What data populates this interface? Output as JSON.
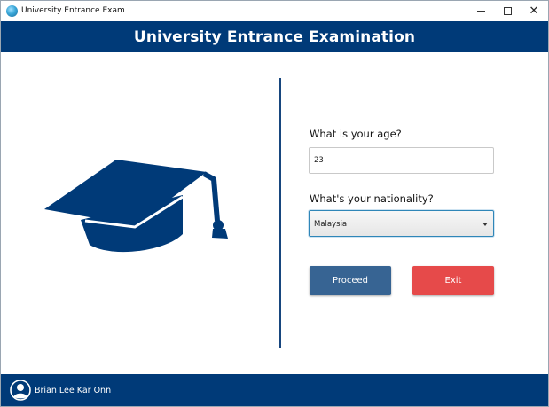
{
  "window": {
    "title": "University Entrance Exam",
    "icon": "globe-icon",
    "controls": [
      "minimize-icon",
      "maximize-icon",
      "close-icon"
    ]
  },
  "header": {
    "title": "University Entrance Examination"
  },
  "illustration": {
    "icon": "graduation-cap-icon",
    "color": "#003a78"
  },
  "form": {
    "age_label": "What is your age?",
    "age_value": "23",
    "nationality_label": "What's your nationality?",
    "nationality_value": "Malaysia"
  },
  "buttons": {
    "proceed_label": "Proceed",
    "exit_label": "Exit"
  },
  "footer": {
    "user_name": "Brian Lee Kar Onn",
    "avatar_icon": "user-avatar-icon"
  },
  "colors": {
    "primary": "#003a78",
    "proceed": "#376493",
    "exit": "#e64a4a"
  }
}
